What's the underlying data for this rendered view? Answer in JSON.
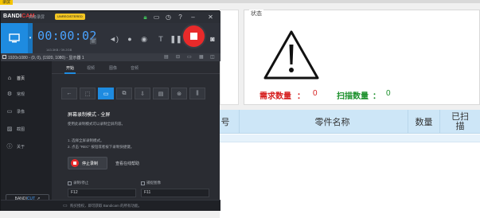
{
  "background_app": {
    "corner_tag": "录屏",
    "status_panel": {
      "title": "状态",
      "warning_icon": "warning-triangle-icon",
      "demand_label": "需求数量",
      "demand_colon": "：",
      "demand_value": "0",
      "scan_label": "扫描数量",
      "scan_colon": "：",
      "scan_value": "0",
      "demand_color": "#d62020",
      "scan_color": "#1a8f2a"
    },
    "table": {
      "columns": [
        "号",
        "零件名称",
        "数量",
        "已扫",
        "描"
      ]
    }
  },
  "bandicam": {
    "logo_main": "BANDI",
    "logo_cam": "CAM",
    "subtitle": "高级录屏",
    "unregistered": "UNREGISTERED",
    "toolbar": {
      "timer": "00:00:02",
      "size_info": "143.3KB / 39.2GB",
      "icons": [
        "screen-mode-icon",
        "webcam-icon",
        "speaker-icon",
        "microphone-icon",
        "cursor-effect-icon",
        "text-icon",
        "pause-icon",
        "record-stop-icon",
        "screenshot-icon"
      ]
    },
    "region_text": "1920x1080 - (0, 0), (1920, 1080) - 显示器 1",
    "sidebar": {
      "items": [
        {
          "label": "首页",
          "icon": "home-icon"
        },
        {
          "label": "常规",
          "icon": "gear-icon"
        },
        {
          "label": "录像",
          "icon": "video-icon"
        },
        {
          "label": "截图",
          "icon": "image-icon"
        },
        {
          "label": "关于",
          "icon": "info-icon"
        }
      ],
      "bandicut_main": "BANDI",
      "bandicut_cut": "CUT",
      "bandicut_arrow": "↗"
    },
    "tabs": [
      "开始",
      "视频",
      "图像",
      "音频"
    ],
    "content": {
      "title": "屏幕录制模式 - 全屏",
      "description": "使用此录制模式可以录制全屏内容。",
      "step1": "1. 选择全屏录制模式。",
      "step2": "2. 点击 \"REC\" 按钮或者按下录制快捷键。",
      "stop_button": "停止录制",
      "help_link": "查看在线帮助",
      "hotkey1_label": "录制/停止",
      "hotkey1_value": "F12",
      "hotkey2_label": "捕捉图像",
      "hotkey2_value": "F11"
    },
    "footer": "购买授权，即可获取 Bandicam 的所有功能。"
  }
}
